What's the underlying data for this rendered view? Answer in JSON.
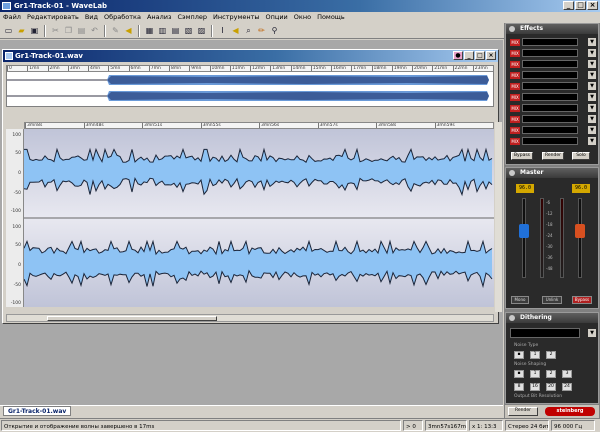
{
  "app": {
    "title": "Gr1-Track-01 - WaveLab"
  },
  "window_controls": {
    "minimize": "_",
    "maximize": "□",
    "close": "×"
  },
  "menu": [
    "Файл",
    "Редактировать",
    "Вид",
    "Обработка",
    "Анализ",
    "Сэмплер",
    "Инструменты",
    "Опции",
    "Окно",
    "Помощь"
  ],
  "toolbar": {
    "groups": [
      [
        "new-icon",
        "open-icon",
        "save-icon"
      ],
      [
        "cut-icon",
        "copy-icon",
        "paste-icon",
        "undo-icon"
      ],
      [
        "draw-icon",
        "speaker-icon"
      ],
      [
        "view1-icon",
        "view2-icon",
        "view3-icon",
        "view4-icon",
        "view5-icon"
      ],
      [
        "cursor-icon",
        "play-icon",
        "zoom-icon",
        "pencil-icon",
        "tool-icon"
      ]
    ]
  },
  "document": {
    "title": "Gr1-Track-01.wav",
    "overview_ruler": [
      "0",
      "1mn",
      "2mn",
      "3mn",
      "4mn",
      "5mn",
      "6mn",
      "7mn",
      "8mn",
      "9mn",
      "10mn",
      "11mn",
      "12mn",
      "13mn",
      "14mn",
      "15mn",
      "16mn",
      "17mn",
      "18mn",
      "19mn",
      "20mn",
      "21mn",
      "22mn",
      "23mn"
    ],
    "main_ruler": [
      "3mn8s",
      "3mn48s",
      "3mn51s",
      "3mn55s",
      "3mn56s",
      "3mn57s",
      "3mn58s",
      "3mn59s"
    ],
    "yaxis_top": [
      "100",
      "50",
      "0",
      "-50",
      "-100"
    ],
    "yaxis_bottom": [
      "100",
      "50",
      "0",
      "-50",
      "-100"
    ]
  },
  "tab": {
    "label": "Gr1-Track-01.wav"
  },
  "status": {
    "message": "Открытие и отображение волны завершено в 17ms",
    "segments": [
      "> 0",
      "3mn57s167ms",
      "x 1: 13:3",
      "Стерео 24 бит",
      "96 000 Гц"
    ]
  },
  "effects_panel": {
    "title": "Effects",
    "slots": [
      "",
      "",
      "",
      "",
      "",
      "",
      "",
      "",
      "",
      ""
    ],
    "slot_tag": "MIX",
    "buttons": [
      "Bypass",
      "Render",
      "Solo"
    ]
  },
  "master_panel": {
    "title": "Master",
    "left_value": "96.0",
    "right_value": "96.0",
    "scale": [
      "-6",
      "-12",
      "-18",
      "-24",
      "-30",
      "-36",
      "-48"
    ],
    "buttons": [
      "Mono",
      "Unlink",
      "Bypass"
    ]
  },
  "dithering_panel": {
    "title": "Dithering",
    "labels": [
      "Noise",
      "Type",
      "Noise",
      "Shaping",
      "Output Bit Resolution"
    ],
    "type_options": [
      "1",
      "2"
    ],
    "shaping_options": [
      "1",
      "2",
      "3"
    ],
    "bit_options": [
      "8",
      "16",
      "20",
      "24"
    ]
  },
  "footer": {
    "render_label": "Render",
    "brand": "steinberg"
  }
}
